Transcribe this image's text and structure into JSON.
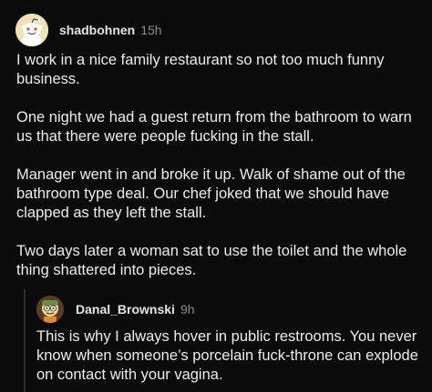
{
  "comment": {
    "username": "shadbohnen",
    "time": "15h",
    "avatar_icon": "snoo-avatar",
    "paragraphs": [
      "I work in a nice family restaurant so not too much funny business.",
      "One night we had a guest return from the bathroom to warn us that there were people fucking in the stall.",
      "Manager went in and broke it up. Walk of shame out of the bathroom type deal.  Our chef joked that we should have clapped as they left the stall.",
      "Two days later a woman sat to use the toilet and the whole thing shattered into pieces."
    ]
  },
  "reply": {
    "username": "Danal_Brownski",
    "time": "9h",
    "avatar_icon": "character-avatar",
    "text": "This is why I always hover in public restrooms. You never know when someone’s porcelain fuck-throne can explode on contact with your vagina."
  },
  "colors": {
    "background": "#0b0b0b",
    "text": "#ececec",
    "muted": "#8a8a8a",
    "thread_line": "#2e2e2e"
  }
}
